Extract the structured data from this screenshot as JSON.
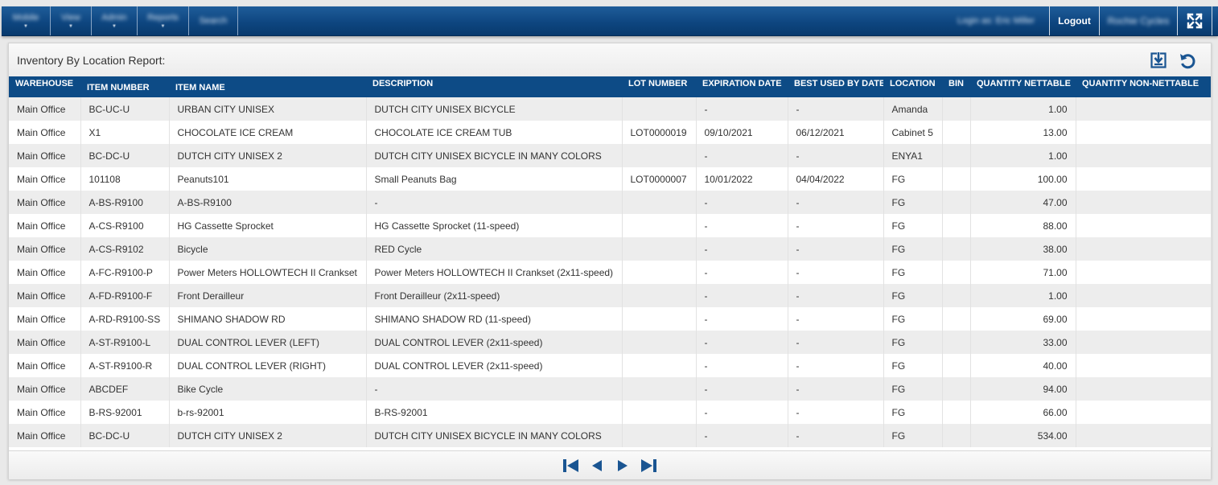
{
  "nav": {
    "menus": [
      {
        "label": "Mobile",
        "left": 0
      },
      {
        "label": "View"
      },
      {
        "label": "Admin"
      },
      {
        "label": "Reports"
      },
      {
        "label": "Search"
      }
    ],
    "login_as": "Login as: Eric Miller",
    "logout_label": "Logout",
    "company": "Rochie Cycles",
    "fullscreen_icon": "fullscreen-icon"
  },
  "report": {
    "title": "Inventory By Location Report:",
    "export_icon": "download-icon",
    "refresh_icon": "refresh-icon",
    "columns": [
      "WAREHOUSE",
      "ITEM NUMBER",
      "ITEM NAME",
      "DESCRIPTION",
      "LOT NUMBER",
      "EXPIRATION DATE",
      "BEST USED BY DATE",
      "LOCATION",
      "BIN",
      "QUANTITY NETTABLE",
      "QUANTITY NON-NETTABLE"
    ],
    "rows": [
      [
        "Main Office",
        "BC-UC-U",
        "URBAN CITY UNISEX",
        "DUTCH CITY UNISEX BICYCLE",
        "",
        "-",
        "-",
        "Amanda",
        "",
        "1.00",
        ""
      ],
      [
        "Main Office",
        "X1",
        "CHOCOLATE ICE CREAM",
        "CHOCOLATE ICE CREAM TUB",
        "LOT0000019",
        "09/10/2021",
        "06/12/2021",
        "Cabinet 5",
        "",
        "13.00",
        ""
      ],
      [
        "Main Office",
        "BC-DC-U",
        "DUTCH CITY UNISEX 2",
        "DUTCH CITY UNISEX BICYCLE IN MANY COLORS",
        "",
        "-",
        "-",
        "ENYA1",
        "",
        "1.00",
        ""
      ],
      [
        "Main Office",
        "101108",
        "Peanuts101",
        "Small Peanuts Bag",
        "LOT0000007",
        "10/01/2022",
        "04/04/2022",
        "FG",
        "",
        "100.00",
        ""
      ],
      [
        "Main Office",
        "A-BS-R9100",
        "A-BS-R9100",
        "-",
        "",
        "-",
        "-",
        "FG",
        "",
        "47.00",
        ""
      ],
      [
        "Main Office",
        "A-CS-R9100",
        "HG Cassette Sprocket",
        "HG Cassette Sprocket (11-speed)",
        "",
        "-",
        "-",
        "FG",
        "",
        "88.00",
        ""
      ],
      [
        "Main Office",
        "A-CS-R9102",
        "Bicycle",
        "RED Cycle",
        "",
        "-",
        "-",
        "FG",
        "",
        "38.00",
        ""
      ],
      [
        "Main Office",
        "A-FC-R9100-P",
        "Power Meters HOLLOWTECH II Crankset",
        "Power Meters HOLLOWTECH II Crankset (2x11-speed)",
        "",
        "-",
        "-",
        "FG",
        "",
        "71.00",
        ""
      ],
      [
        "Main Office",
        "A-FD-R9100-F",
        "Front Derailleur",
        "Front Derailleur (2x11-speed)",
        "",
        "-",
        "-",
        "FG",
        "",
        "1.00",
        ""
      ],
      [
        "Main Office",
        "A-RD-R9100-SS",
        "SHIMANO SHADOW RD",
        "SHIMANO SHADOW RD (11-speed)",
        "",
        "-",
        "-",
        "FG",
        "",
        "69.00",
        ""
      ],
      [
        "Main Office",
        "A-ST-R9100-L",
        "DUAL CONTROL LEVER (LEFT)",
        "DUAL CONTROL LEVER (2x11-speed)",
        "",
        "-",
        "-",
        "FG",
        "",
        "33.00",
        ""
      ],
      [
        "Main Office",
        "A-ST-R9100-R",
        "DUAL CONTROL LEVER (RIGHT)",
        "DUAL CONTROL LEVER (2x11-speed)",
        "",
        "-",
        "-",
        "FG",
        "",
        "40.00",
        ""
      ],
      [
        "Main Office",
        "ABCDEF",
        "Bike Cycle",
        "-",
        "",
        "-",
        "-",
        "FG",
        "",
        "94.00",
        ""
      ],
      [
        "Main Office",
        "B-RS-92001",
        "b-rs-92001",
        "B-RS-92001",
        "",
        "-",
        "-",
        "FG",
        "",
        "66.00",
        ""
      ],
      [
        "Main Office",
        "BC-DC-U",
        "DUTCH CITY UNISEX 2",
        "DUTCH CITY UNISEX BICYCLE IN MANY COLORS",
        "",
        "-",
        "-",
        "FG",
        "",
        "534.00",
        ""
      ]
    ]
  },
  "pager": {
    "first_icon": "first-page-icon",
    "prev_icon": "prev-page-icon",
    "next_icon": "next-page-icon",
    "last_icon": "last-page-icon"
  }
}
